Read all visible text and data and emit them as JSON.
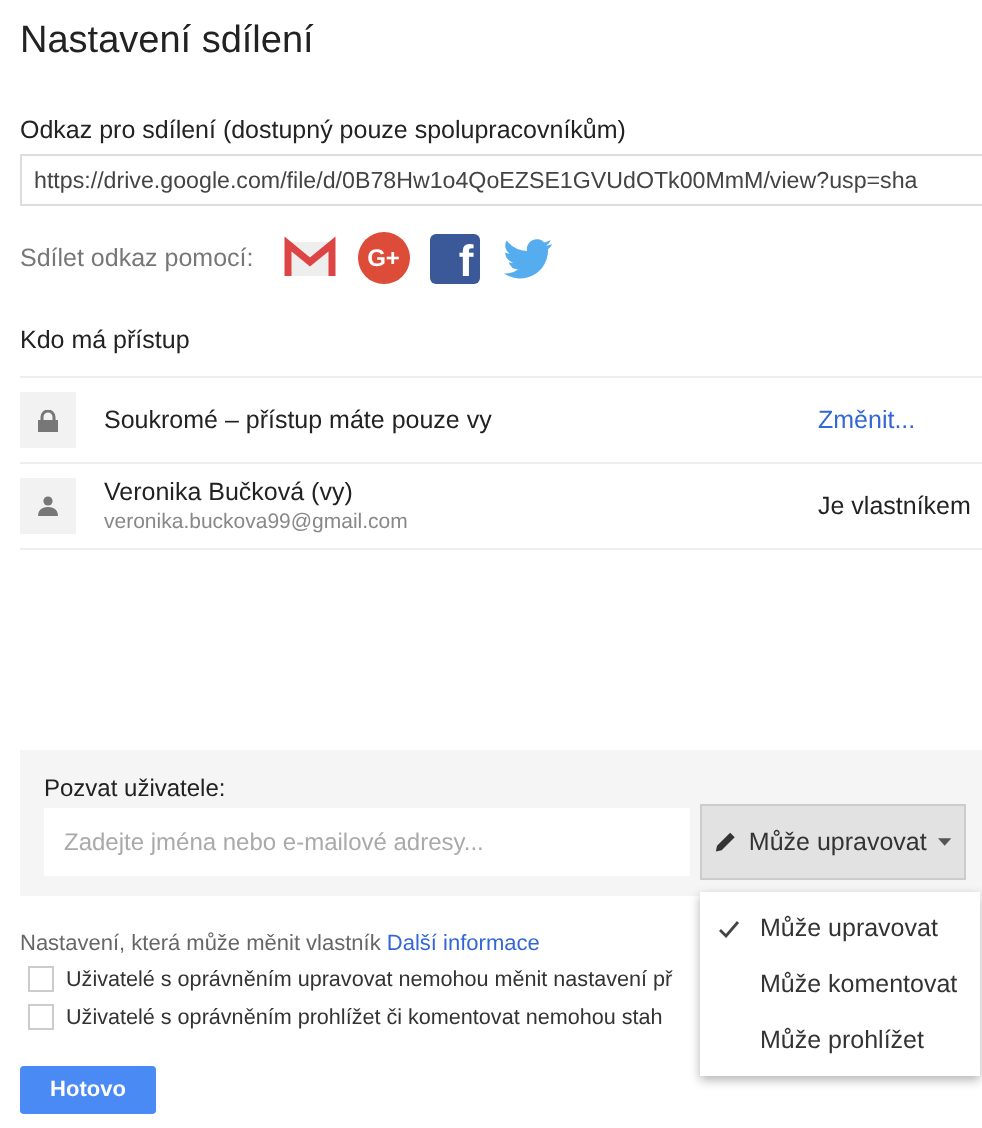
{
  "title": "Nastavení sdílení",
  "link": {
    "label": "Odkaz pro sdílení (dostupný pouze spolupracovníkům)",
    "value": "https://drive.google.com/file/d/0B78Hw1o4QoEZSE1GVUdOTk00MmM/view?usp=sha"
  },
  "share": {
    "label": "Sdílet odkaz pomocí:",
    "services": [
      {
        "kind": "gmail"
      },
      {
        "kind": "gplus",
        "label": "G+"
      },
      {
        "kind": "facebook",
        "label": "f"
      },
      {
        "kind": "twitter"
      }
    ]
  },
  "access": {
    "heading": "Kdo má přístup",
    "rows": [
      {
        "kind": "visibility",
        "name": "Soukromé – přístup máte pouze vy",
        "action": "Změnit..."
      },
      {
        "kind": "person",
        "name": "Veronika Bučková (vy)",
        "email": "veronika.buckova99@gmail.com",
        "role": "Je vlastníkem"
      }
    ]
  },
  "invite": {
    "label": "Pozvat uživatele:",
    "placeholder": "Zadejte jména nebo e-mailové adresy...",
    "permission": "Může upravovat",
    "options": [
      {
        "label": "Může upravovat",
        "selected": true
      },
      {
        "label": "Může komentovat",
        "selected": false
      },
      {
        "label": "Může prohlížet",
        "selected": false
      }
    ]
  },
  "owner_settings": {
    "text": "Nastavení, která může měnit vlastník",
    "link": "Další informace",
    "checkboxes": [
      {
        "label": "Uživatelé s oprávněním upravovat nemohou měnit nastavení př",
        "checked": false
      },
      {
        "label": "Uživatelé s oprávněním prohlížet či komentovat nemohou stah",
        "checked": false
      }
    ]
  },
  "done_button": "Hotovo"
}
